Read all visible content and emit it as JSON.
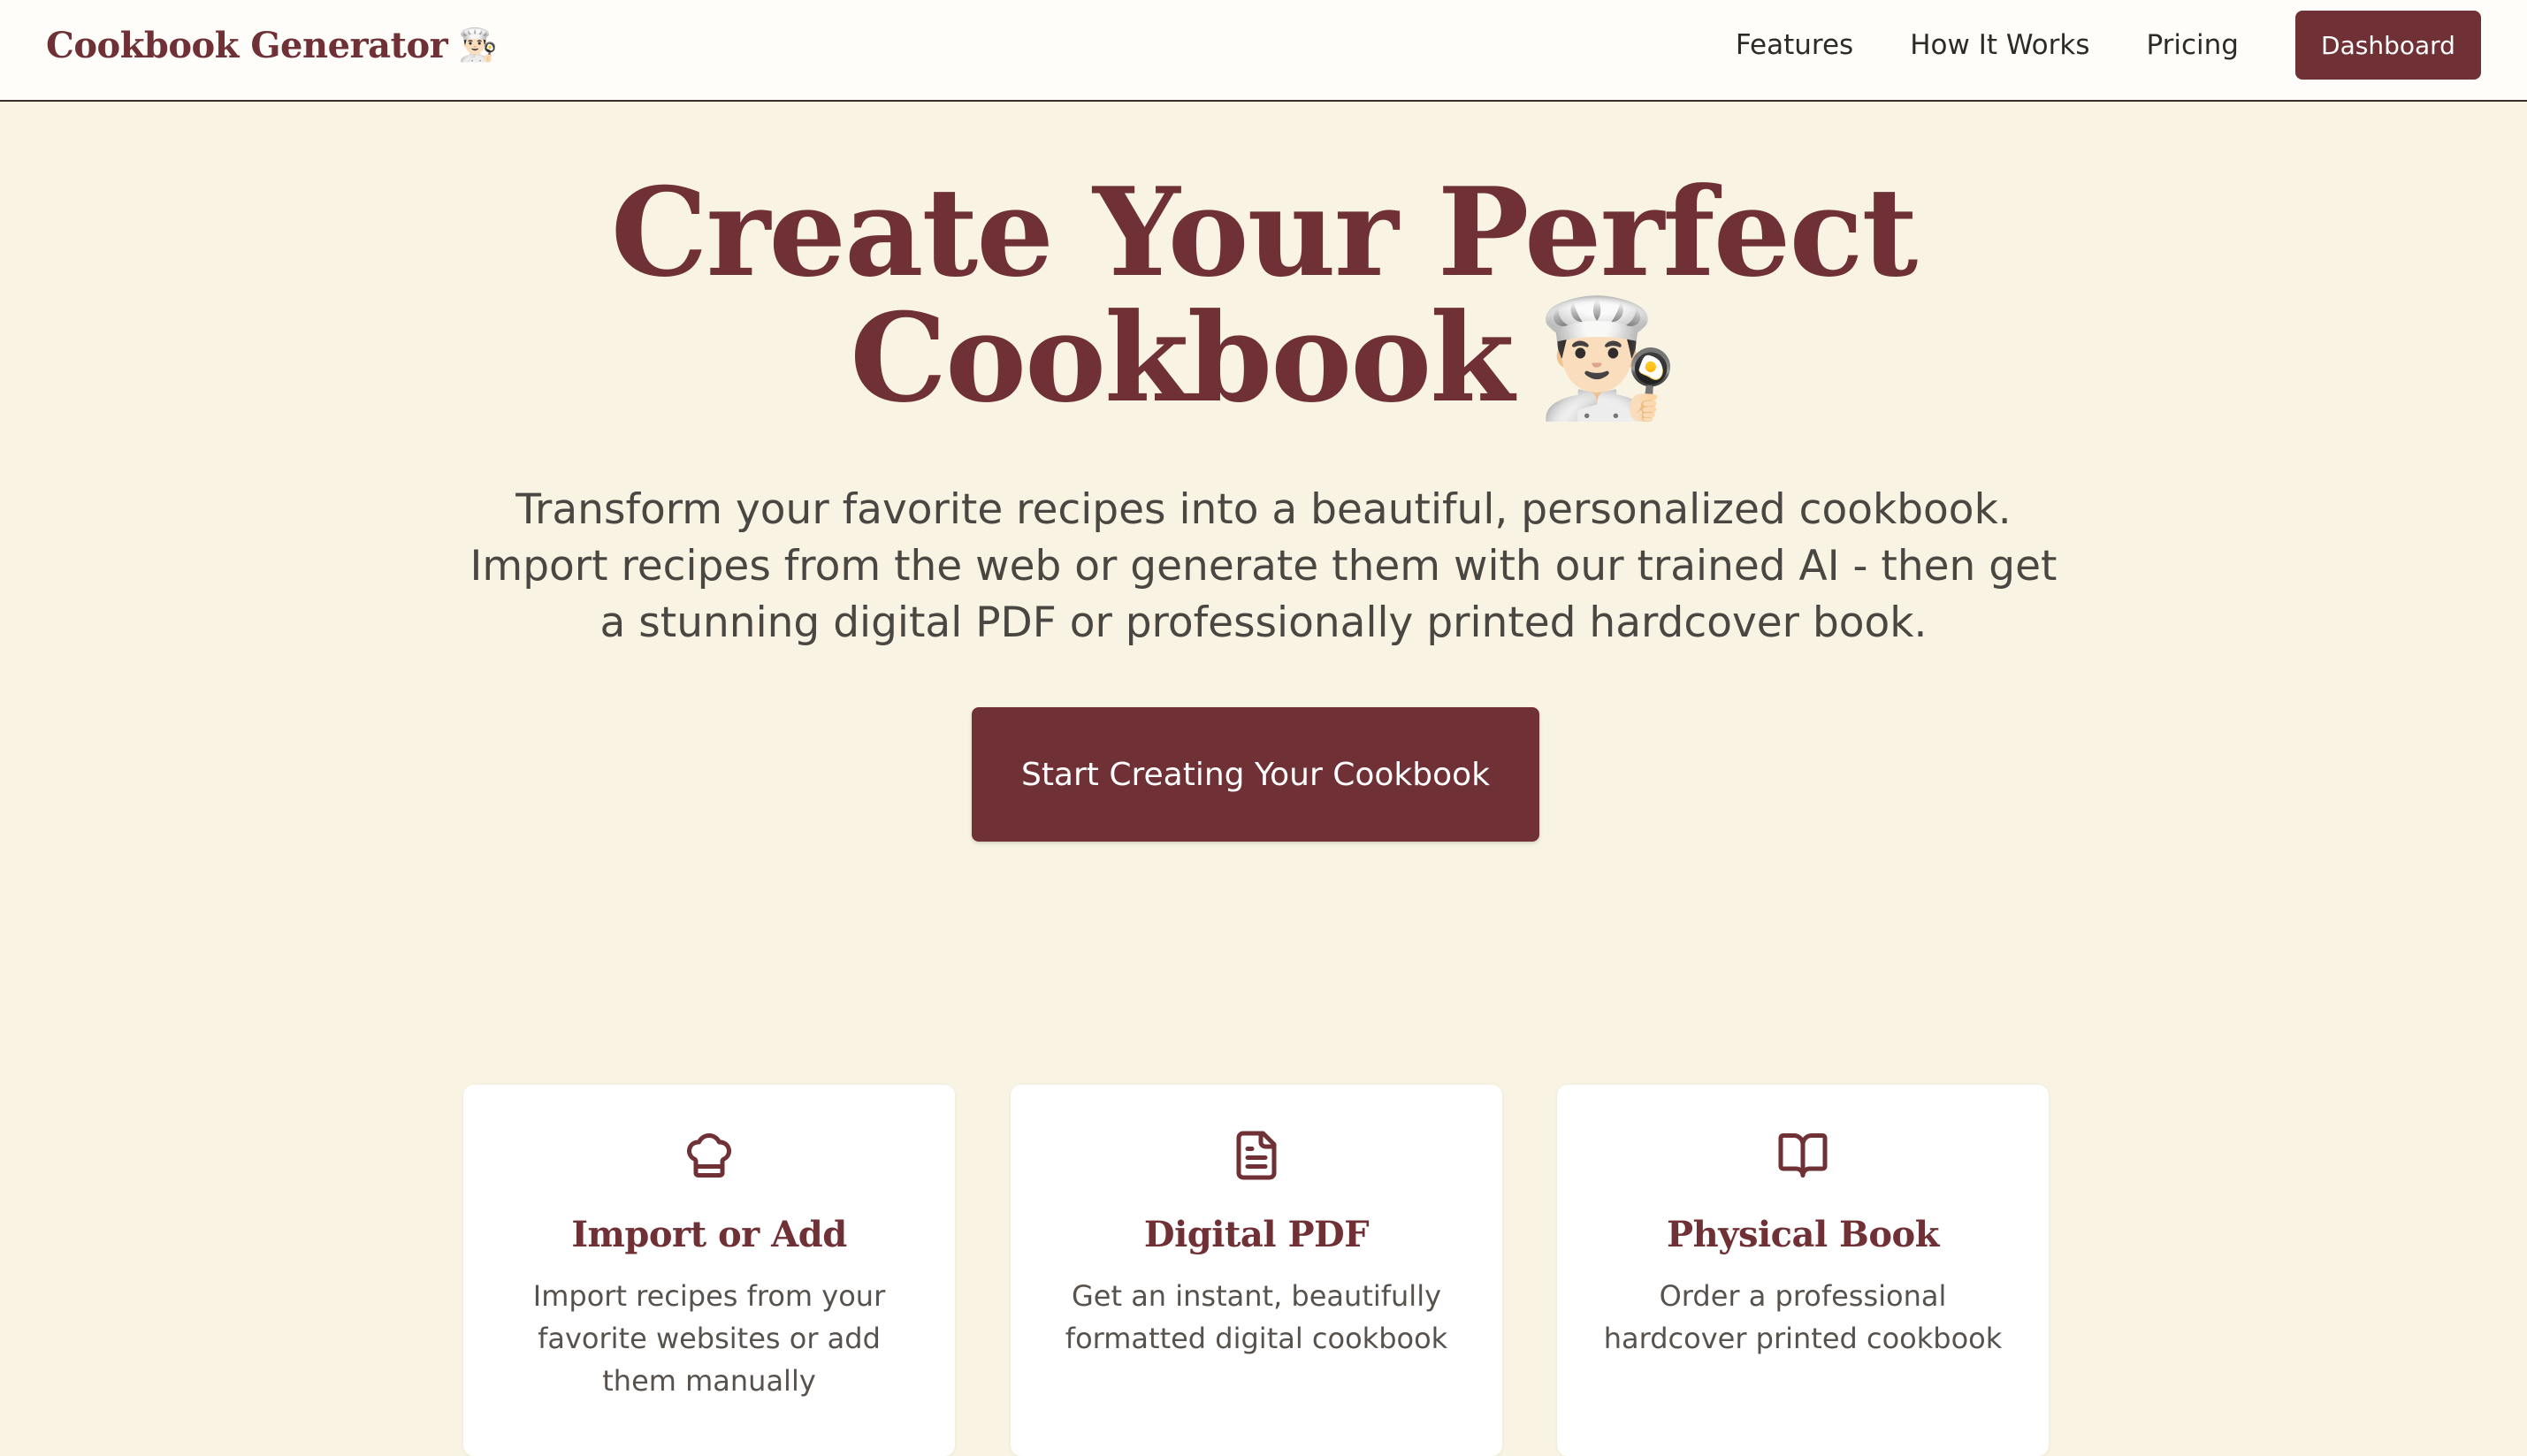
{
  "header": {
    "brand": "Cookbook Generator",
    "brand_emoji": "👨🏻‍🍳",
    "nav": [
      {
        "label": "Features"
      },
      {
        "label": "How It Works"
      },
      {
        "label": "Pricing"
      }
    ],
    "dashboard_label": "Dashboard"
  },
  "hero": {
    "title_line1": "Create Your Perfect",
    "title_line2": "Cookbook",
    "title_emoji": "👨🏻‍🍳",
    "subtitle": "Transform your favorite recipes into a beautiful, personalized cookbook. Import recipes from the web or generate them with our trained AI - then get a stunning digital PDF or professionally printed hardcover book.",
    "cta_label": "Start Creating Your Cookbook"
  },
  "features": [
    {
      "icon": "chef-hat-icon",
      "title": "Import or Add",
      "description": "Import recipes from your favorite websites or add them manually"
    },
    {
      "icon": "document-icon",
      "title": "Digital PDF",
      "description": "Get an instant, beautifully formatted digital cookbook"
    },
    {
      "icon": "open-book-icon",
      "title": "Physical Book",
      "description": "Order a professional hardcover printed cookbook"
    }
  ],
  "colors": {
    "brand": "#6f3136",
    "background": "#f8f3e2",
    "header_background": "#fefdf9",
    "card_background": "#ffffff"
  }
}
